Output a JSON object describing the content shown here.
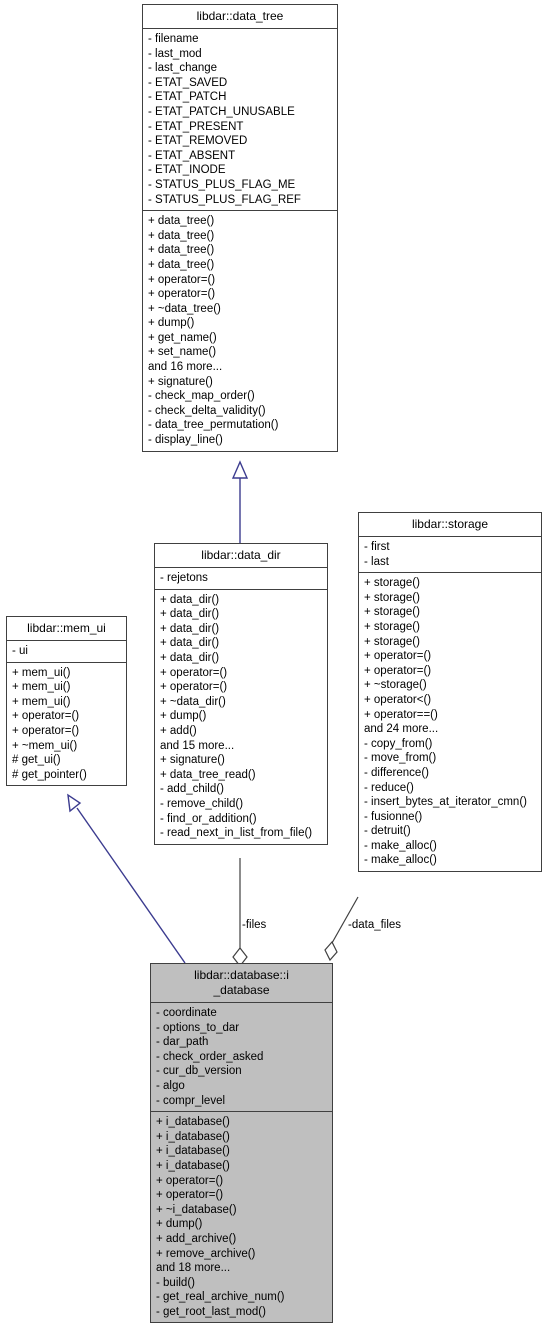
{
  "diagram": {
    "type": "uml-class-diagram",
    "background": "#ffffff",
    "inheritance_color": "#3b3b8f",
    "aggregation_color": "#404040",
    "highlight_fill": "#bfbfbf"
  },
  "classes": {
    "data_tree": {
      "title": "libdar::data_tree",
      "attributes": [
        "- filename",
        "- last_mod",
        "- last_change",
        "- ETAT_SAVED",
        "- ETAT_PATCH",
        "- ETAT_PATCH_UNUSABLE",
        "- ETAT_PRESENT",
        "- ETAT_REMOVED",
        "- ETAT_ABSENT",
        "- ETAT_INODE",
        "- STATUS_PLUS_FLAG_ME",
        "- STATUS_PLUS_FLAG_REF"
      ],
      "operations": [
        "+ data_tree()",
        "+ data_tree()",
        "+ data_tree()",
        "+ data_tree()",
        "+ operator=()",
        "+ operator=()",
        "+ ~data_tree()",
        "+ dump()",
        "+ get_name()",
        "+ set_name()",
        "and 16 more...",
        "+ signature()",
        "- check_map_order()",
        "- check_delta_validity()",
        "- data_tree_permutation()",
        "- display_line()"
      ]
    },
    "data_dir": {
      "title": "libdar::data_dir",
      "attributes": [
        "- rejetons"
      ],
      "operations": [
        "+ data_dir()",
        "+ data_dir()",
        "+ data_dir()",
        "+ data_dir()",
        "+ data_dir()",
        "+ operator=()",
        "+ operator=()",
        "+ ~data_dir()",
        "+ dump()",
        "+ add()",
        "and 15 more...",
        "+ signature()",
        "+ data_tree_read()",
        "- add_child()",
        "- remove_child()",
        "- find_or_addition()",
        "- read_next_in_list_from_file()"
      ]
    },
    "storage": {
      "title": "libdar::storage",
      "attributes": [
        "- first",
        "- last"
      ],
      "operations": [
        "+ storage()",
        "+ storage()",
        "+ storage()",
        "+ storage()",
        "+ storage()",
        "+ operator=()",
        "+ operator=()",
        "+ ~storage()",
        "+ operator<()",
        "+ operator==()",
        "and 24 more...",
        "- copy_from()",
        "- move_from()",
        "- difference()",
        "- reduce()",
        "- insert_bytes_at_iterator_cmn()",
        "- fusionne()",
        "- detruit()",
        "- make_alloc()",
        "- make_alloc()"
      ]
    },
    "mem_ui": {
      "title": "libdar::mem_ui",
      "attributes": [
        "- ui"
      ],
      "operations": [
        "+ mem_ui()",
        "+ mem_ui()",
        "+ mem_ui()",
        "+ operator=()",
        "+ operator=()",
        "+ ~mem_ui()",
        "# get_ui()",
        "# get_pointer()"
      ]
    },
    "i_database": {
      "title": "libdar::database::i\n_database",
      "attributes": [
        "- coordinate",
        "- options_to_dar",
        "- dar_path",
        "- check_order_asked",
        "- cur_db_version",
        "- algo",
        "- compr_level"
      ],
      "operations": [
        "+ i_database()",
        "+ i_database()",
        "+ i_database()",
        "+ i_database()",
        "+ operator=()",
        "+ operator=()",
        "+ ~i_database()",
        "+ dump()",
        "+ add_archive()",
        "+ remove_archive()",
        "and 18 more...",
        "- build()",
        "- get_real_archive_num()",
        "- get_root_last_mod()"
      ]
    }
  },
  "edge_labels": {
    "files": "-files",
    "data_files": "-data_files"
  }
}
